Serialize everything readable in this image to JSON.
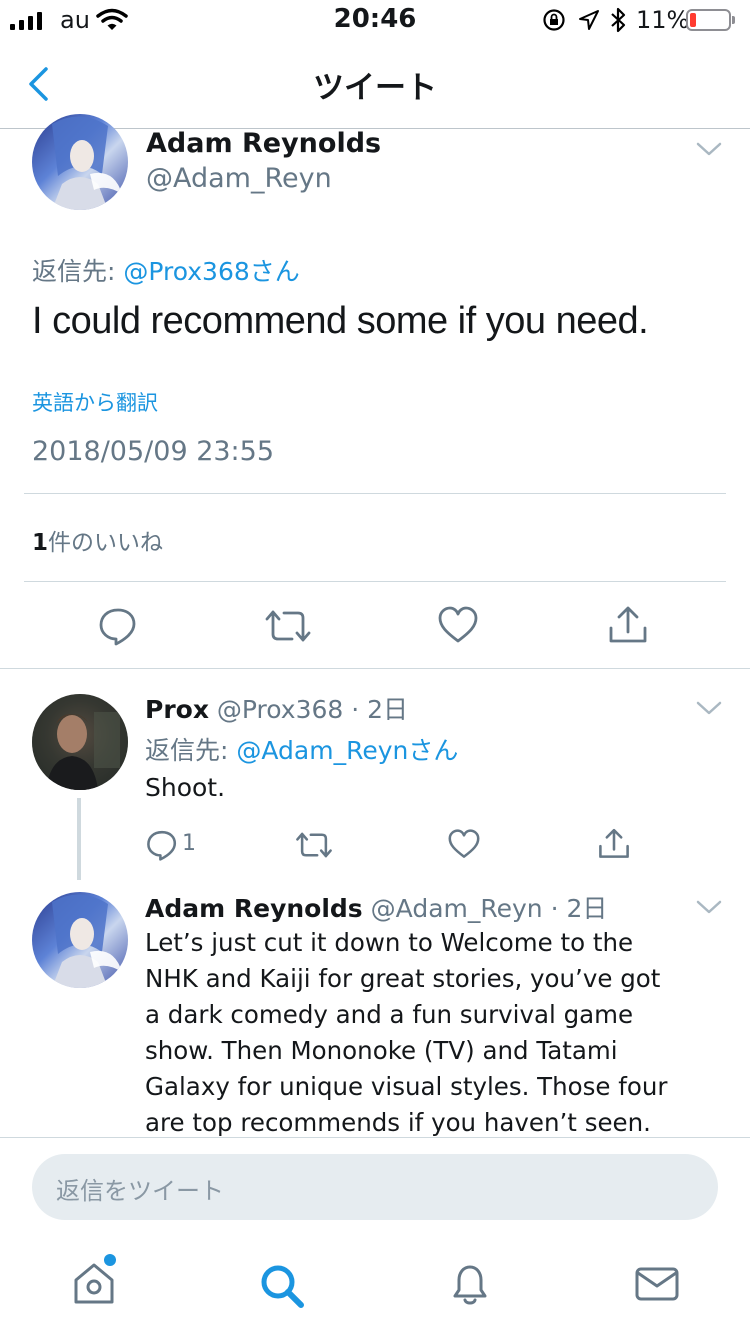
{
  "status_bar": {
    "carrier": "au",
    "time": "20:46",
    "battery": "11%"
  },
  "nav": {
    "title": "ツイート"
  },
  "main_tweet": {
    "author_name": "Adam Reynolds",
    "author_handle": "@Adam_Reyn",
    "reply_prefix": "返信先: ",
    "reply_to": "@Prox368さん",
    "text": "I could recommend some if you need.",
    "translate": "英語から翻訳",
    "timestamp": "2018/05/09 23:55",
    "likes_count": "1",
    "likes_label": "件のいいね"
  },
  "reply1": {
    "author_name": "Prox",
    "meta": "@Prox368 · 2日",
    "reply_prefix": "返信先: ",
    "reply_to": "@Adam_Reynさん",
    "text": "Shoot.",
    "reply_count": "1"
  },
  "reply2": {
    "author_name": "Adam Reynolds",
    "meta": "@Adam_Reyn · 2日",
    "lines": [
      "Let’s just cut it down to Welcome to the",
      "NHK and Kaiji for great stories, you’ve got",
      "a dark comedy and a fun survival game",
      "show.  Then Mononoke (TV) and Tatami",
      "Galaxy for unique visual styles.  Those four",
      "are top recommends if you haven’t seen."
    ]
  },
  "composer": {
    "placeholder": "返信をツイート"
  },
  "tab_bar": {
    "items": [
      "home-icon",
      "search-icon",
      "notifications-icon",
      "messages-icon"
    ]
  },
  "colors": {
    "accent": "#1b95e0",
    "secondary": "#657786",
    "divider": "#cfd9de",
    "battery_low": "#ff3b30"
  }
}
